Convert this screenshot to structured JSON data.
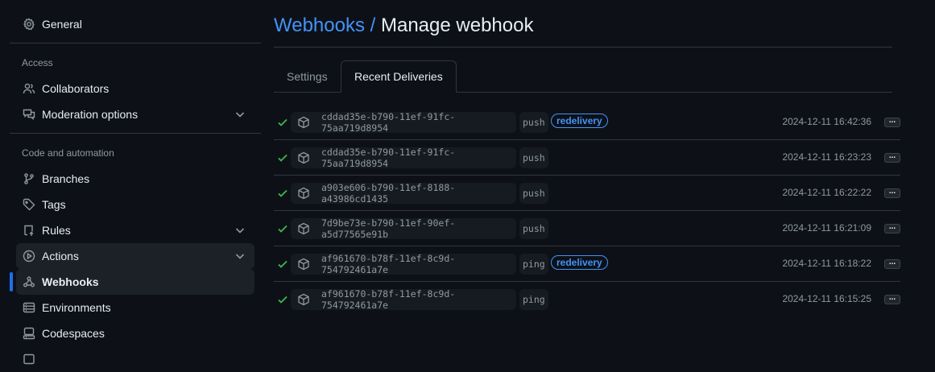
{
  "sidebar": {
    "general": "General",
    "access_label": "Access",
    "collaborators": "Collaborators",
    "moderation": "Moderation options",
    "code_label": "Code and automation",
    "branches": "Branches",
    "tags": "Tags",
    "rules": "Rules",
    "actions": "Actions",
    "webhooks": "Webhooks",
    "environments": "Environments",
    "codespaces": "Codespaces"
  },
  "header": {
    "crumb": "Webhooks",
    "separator": "/",
    "title": "Manage webhook"
  },
  "tabs": {
    "settings": "Settings",
    "recent": "Recent Deliveries"
  },
  "deliveries": [
    {
      "guid": "cddad35e-b790-11ef-91fc-75aa719d8954",
      "event": "push",
      "badge": "redelivery",
      "time": "2024-12-11 16:42:36"
    },
    {
      "guid": "cddad35e-b790-11ef-91fc-75aa719d8954",
      "event": "push",
      "badge": "",
      "time": "2024-12-11 16:23:23"
    },
    {
      "guid": "a903e606-b790-11ef-8188-a43986cd1435",
      "event": "push",
      "badge": "",
      "time": "2024-12-11 16:22:22"
    },
    {
      "guid": "7d9be73e-b790-11ef-90ef-a5d77565e91b",
      "event": "push",
      "badge": "",
      "time": "2024-12-11 16:21:09"
    },
    {
      "guid": "af961670-b78f-11ef-8c9d-754792461a7e",
      "event": "ping",
      "badge": "redelivery",
      "time": "2024-12-11 16:18:22"
    },
    {
      "guid": "af961670-b78f-11ef-8c9d-754792461a7e",
      "event": "ping",
      "badge": "",
      "time": "2024-12-11 16:15:25"
    }
  ],
  "more_label": "...",
  "colors": {
    "accent": "#4493f8",
    "success": "#3fb950",
    "background": "#0d1117"
  }
}
